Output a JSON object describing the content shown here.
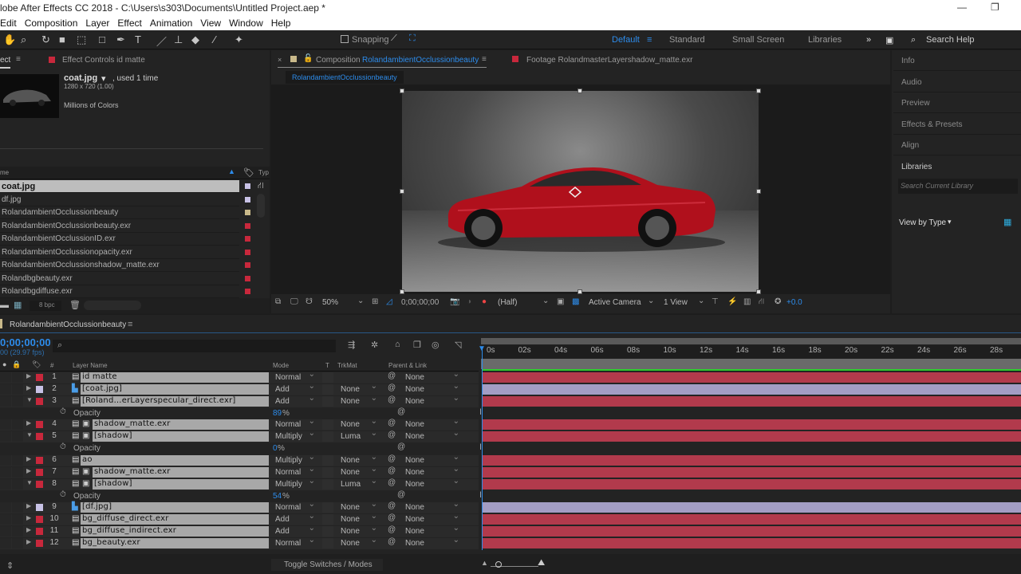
{
  "title": "lobe After Effects CC 2018 - C:\\Users\\s303\\Documents\\Untitled Project.aep *",
  "menu": [
    "Edit",
    "Composition",
    "Layer",
    "Effect",
    "Animation",
    "View",
    "Window",
    "Help"
  ],
  "toolbar": {
    "snapping": "Snapping"
  },
  "workspaces": {
    "default": "Default",
    "standard": "Standard",
    "small_screen": "Small Screen",
    "libraries": "Libraries",
    "search_help": "Search Help"
  },
  "project": {
    "tab_label": "ect",
    "effect_controls_tab": "Effect Controls id matte",
    "preview_name": "coat.jpg",
    "used": ", used 1 time",
    "dims": "1280 x 720 (1.00)",
    "colors": "Millions of Colors",
    "col_name": "me",
    "col_type": "Typ",
    "bpc": "8 bpc",
    "items": [
      {
        "name": "coat.jpg",
        "color": "#c8c2e6",
        "selected": true
      },
      {
        "name": "df.jpg",
        "color": "#c8c2e6"
      },
      {
        "name": "RolandambientOcclussionbeauty",
        "color": "#c9b98a"
      },
      {
        "name": "RolandambientOcclussionbeauty.exr",
        "color": "#c8283c"
      },
      {
        "name": "RolandambientOcclussionID.exr",
        "color": "#c8283c"
      },
      {
        "name": "RolandambientOcclussionopacity.exr",
        "color": "#c8283c"
      },
      {
        "name": "RolandambientOcclussionshadow_matte.exr",
        "color": "#c8283c"
      },
      {
        "name": "Rolandbgbeauty.exr",
        "color": "#c8283c"
      },
      {
        "name": "Rolandbgdiffuse.exr",
        "color": "#c8283c"
      }
    ]
  },
  "composition": {
    "tab_prefix": "Composition",
    "tab_name": "RolandambientOcclussionbeauty",
    "footage_tab": "Footage  RolandmasterLayershadow_matte.exr",
    "breadcrumb": "RolandambientOcclussionbeauty",
    "zoom": "50%",
    "timecode": "0;00;00;00",
    "resolution": "(Half)",
    "camera": "Active Camera",
    "views": "1 View",
    "exposure": "+0.0"
  },
  "right_panel": {
    "items": [
      "Info",
      "Audio",
      "Preview",
      "Effects & Presets",
      "Align",
      "Libraries"
    ],
    "search_placeholder": "Search Current Library",
    "view_by": "View by Type"
  },
  "timeline": {
    "tab": "RolandambientOcclussionbeauty",
    "timecode": "0;00;00;00",
    "fps": "00 (29.97 fps)",
    "columns": {
      "num": "#",
      "layer_name": "Layer Name",
      "mode": "Mode",
      "t": "T",
      "trkmat": "TrkMat",
      "parent": "Parent & Link"
    },
    "ticks": [
      "0s",
      "02s",
      "04s",
      "06s",
      "08s",
      "10s",
      "12s",
      "14s",
      "16s",
      "18s",
      "20s",
      "22s",
      "24s",
      "26s",
      "28s"
    ],
    "toggle": "Toggle Switches / Modes",
    "rows": [
      {
        "num": "1",
        "name": "id matte",
        "color": "#c8283c",
        "mode": "Normal",
        "trkmat": "",
        "parent": "None",
        "expanded": false,
        "track": "#b23a4c"
      },
      {
        "num": "2",
        "name": "[coat.jpg]",
        "color": "#c8c2e6",
        "mode": "Add",
        "trkmat": "None",
        "parent": "None",
        "expanded": false,
        "track": "#a39dc4",
        "image": true
      },
      {
        "num": "3",
        "name": "[Roland…erLayerspecular_direct.exr]",
        "color": "#c8283c",
        "mode": "Add",
        "trkmat": "None",
        "parent": "None",
        "expanded": true,
        "track": "#b23a4c"
      },
      {
        "property": "Opacity",
        "value": "89",
        "unit": " %"
      },
      {
        "num": "4",
        "name": "shadow_matte.exr",
        "color": "#c8283c",
        "mode": "Normal",
        "trkmat": "None",
        "parent": "None",
        "expanded": false,
        "track": "#b23a4c",
        "indent": true
      },
      {
        "num": "5",
        "name": "[shadow]",
        "color": "#c8283c",
        "mode": "Multiply",
        "trkmat": "Luma",
        "parent": "None",
        "expanded": true,
        "track": "#b23a4c",
        "indent": true
      },
      {
        "property": "Opacity",
        "value": "0",
        "unit": " %"
      },
      {
        "num": "6",
        "name": "ao",
        "color": "#c8283c",
        "mode": "Multiply",
        "trkmat": "None",
        "parent": "None",
        "expanded": false,
        "track": "#b23a4c"
      },
      {
        "num": "7",
        "name": "shadow_matte.exr",
        "color": "#c8283c",
        "mode": "Normal",
        "trkmat": "None",
        "parent": "None",
        "expanded": false,
        "track": "#b23a4c",
        "indent": true
      },
      {
        "num": "8",
        "name": "[shadow]",
        "color": "#c8283c",
        "mode": "Multiply",
        "trkmat": "Luma",
        "parent": "None",
        "expanded": true,
        "track": "#b23a4c",
        "indent": true
      },
      {
        "property": "Opacity",
        "value": "54",
        "unit": " %"
      },
      {
        "num": "9",
        "name": "[df.jpg]",
        "color": "#c8c2e6",
        "mode": "Normal",
        "trkmat": "None",
        "parent": "None",
        "expanded": false,
        "track": "#a39dc4",
        "image": true
      },
      {
        "num": "10",
        "name": "bg_diffuse_direct.exr",
        "color": "#c8283c",
        "mode": "Add",
        "trkmat": "None",
        "parent": "None",
        "expanded": false,
        "track": "#b23a4c"
      },
      {
        "num": "11",
        "name": "bg_diffuse_indirect.exr",
        "color": "#c8283c",
        "mode": "Add",
        "trkmat": "None",
        "parent": "None",
        "expanded": false,
        "track": "#b23a4c"
      },
      {
        "num": "12",
        "name": "bg_beauty.exr",
        "color": "#c8283c",
        "mode": "Normal",
        "trkmat": "None",
        "parent": "None",
        "expanded": false,
        "track": "#b23a4c"
      }
    ]
  },
  "accent": "#2d8ceb"
}
